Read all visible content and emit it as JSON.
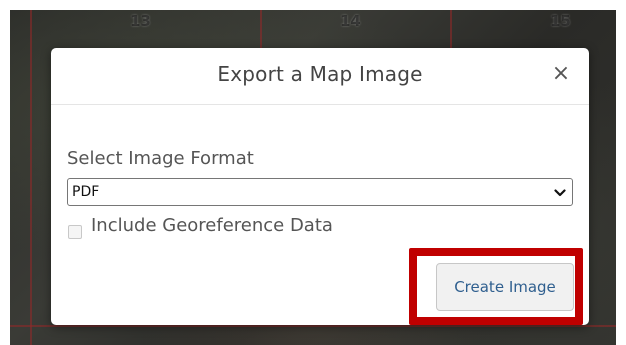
{
  "map": {
    "section_labels": [
      "13",
      "14",
      "15"
    ]
  },
  "dialog": {
    "title": "Export a Map Image",
    "close_glyph": "×",
    "format_label": "Select Image Format",
    "format_selected": "PDF",
    "georef_label": "Include Georeference Data",
    "georef_checked": false,
    "create_button_label": "Create Image"
  },
  "colors": {
    "highlight": "#c00000",
    "button_text": "#2f5f8f"
  }
}
